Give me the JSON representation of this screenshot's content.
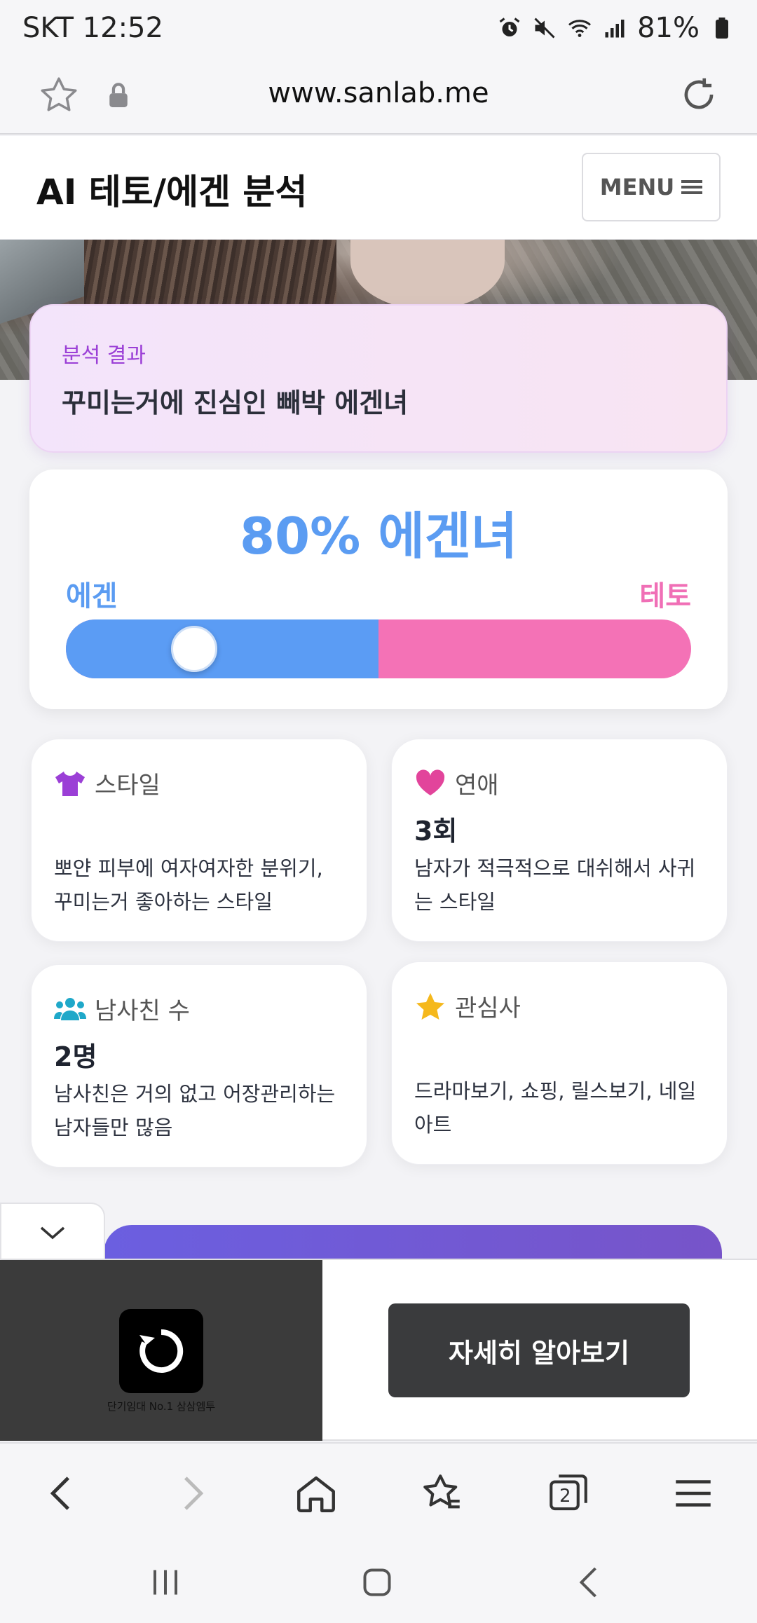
{
  "status_bar": {
    "carrier_time": "SKT 12:52",
    "battery": "81%",
    "icons": [
      "alarm-icon",
      "mute-icon",
      "wifi-icon",
      "signal-icon",
      "battery-icon"
    ]
  },
  "browser": {
    "url": "www.sanlab.me",
    "icons": [
      "star-icon",
      "lock-icon",
      "reload-icon"
    ]
  },
  "site": {
    "brand": "AI 테토/에겐 분석",
    "menu_label": "MENU"
  },
  "result": {
    "label": "분석 결과",
    "title": "꾸미는거에 진심인 빼박 에겐녀"
  },
  "score": {
    "headline": "80% 에겐녀",
    "left_label": "에겐",
    "right_label": "테토",
    "egen_percent": 80,
    "colors": {
      "egen": "#5b9cf4",
      "teto": "#f472b6"
    }
  },
  "cards": {
    "style": {
      "title": "스타일",
      "value": "",
      "desc_line1": "뽀얀 피부에 여자여자한 분위기,",
      "desc_line2": "꾸미는거 좋아하는 스타일",
      "icon": "shirt-icon"
    },
    "dating": {
      "title": "연애",
      "value": "3회",
      "desc_line1": "남자가 적극적으로 대쉬해서 사귀",
      "desc_line2": "는 스타일",
      "icon": "heart-icon"
    },
    "friends": {
      "title": "남사친 수",
      "value": "2명",
      "desc_line1": "남사친은 거의 없고 어장관리하는",
      "desc_line2": "남자들만 많음",
      "icon": "users-icon"
    },
    "interests": {
      "title": "관심사",
      "value": "",
      "desc_line1": "드라마보기, 쇼핑, 릴스보기, 네일",
      "desc_line2": "아트",
      "icon": "star-icon"
    }
  },
  "ad": {
    "caption": "단기임대 No.1 삼삼엠투",
    "cta": "자세히 알아보기",
    "tab_badge": "2"
  }
}
